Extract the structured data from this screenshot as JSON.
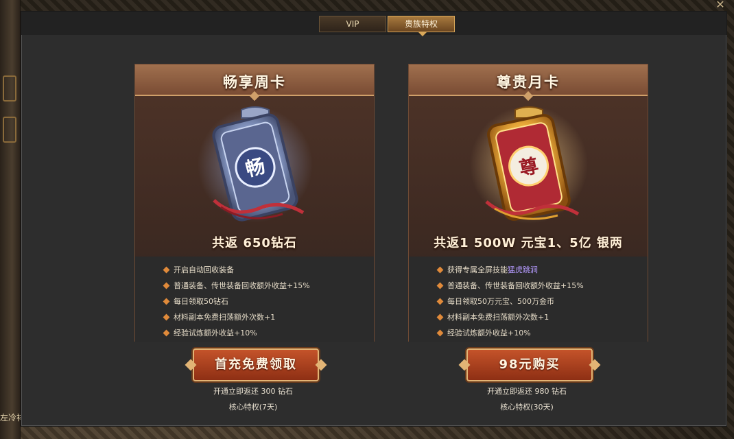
{
  "tabs": [
    {
      "label": "VIP",
      "active": false
    },
    {
      "label": "贵族特权",
      "active": true
    }
  ],
  "close_icon": "close-icon",
  "side_text": "左冷祥",
  "cards": {
    "week": {
      "title": "畅享周卡",
      "badge_char": "畅",
      "reward": "共返 650钻石",
      "perks": [
        "开启自动回收装备",
        "普通装备、传世装备回收额外收益+15%",
        "每日领取50钻石",
        "材料副本免费扫荡额外次数+1",
        "经验试炼额外收益+10%"
      ],
      "button": "首充免费领取",
      "note1": "开通立即返还 300 钻石",
      "note2": "核心特权(7天)"
    },
    "month": {
      "title": "尊贵月卡",
      "badge_char": "尊",
      "reward": "共返1 500W 元宝1、5亿 银两",
      "perks": [
        {
          "prefix": "获得专属全屏技能",
          "highlight": "猛虎跳涧"
        },
        "普通装备、传世装备回收额外收益+15%",
        "每日领取50万元宝、500万金币",
        "材料副本免费扫荡额外次数+1",
        "经验试炼额外收益+10%"
      ],
      "button": "98元购买",
      "note1": "开通立即返还 980 钻石",
      "note2": "核心特权(30天)"
    }
  },
  "colors": {
    "accent_orange": "#e08a3a",
    "highlight_purple": "#b59bff",
    "button_red": "#c4532a",
    "gold_border": "#e2b475"
  }
}
